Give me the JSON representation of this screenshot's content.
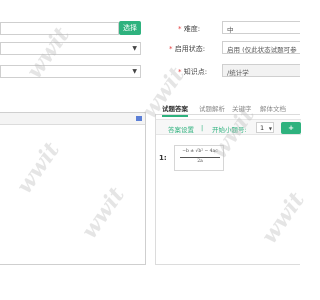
{
  "form": {
    "select_button": "选择",
    "difficulty_label": "难度:",
    "difficulty_value": "中",
    "status_label": "启用状态:",
    "status_value": "启用 (仅此状态试题可参",
    "knowledge_label": "知识点:",
    "knowledge_value": "/统计学"
  },
  "tabs": [
    {
      "label": "试题答案"
    },
    {
      "label": "试题解析"
    },
    {
      "label": "关键字"
    },
    {
      "label": "解体文档"
    }
  ],
  "answer": {
    "settings_label": "答案设置",
    "separator": "|",
    "start_num_label": "开始小题号:",
    "start_num_value": "1",
    "add_label": "+",
    "row_index": "1:",
    "formula_numerator": "−b ± √b² − 4ac",
    "formula_denominator": "2a"
  },
  "editor": {
    "toolbar_icon": "editor-toolbar-icon"
  },
  "watermark_text": "wwit",
  "colors": {
    "accent": "#2eb27e",
    "required": "#e23b3b",
    "border": "#cfcfcf"
  }
}
